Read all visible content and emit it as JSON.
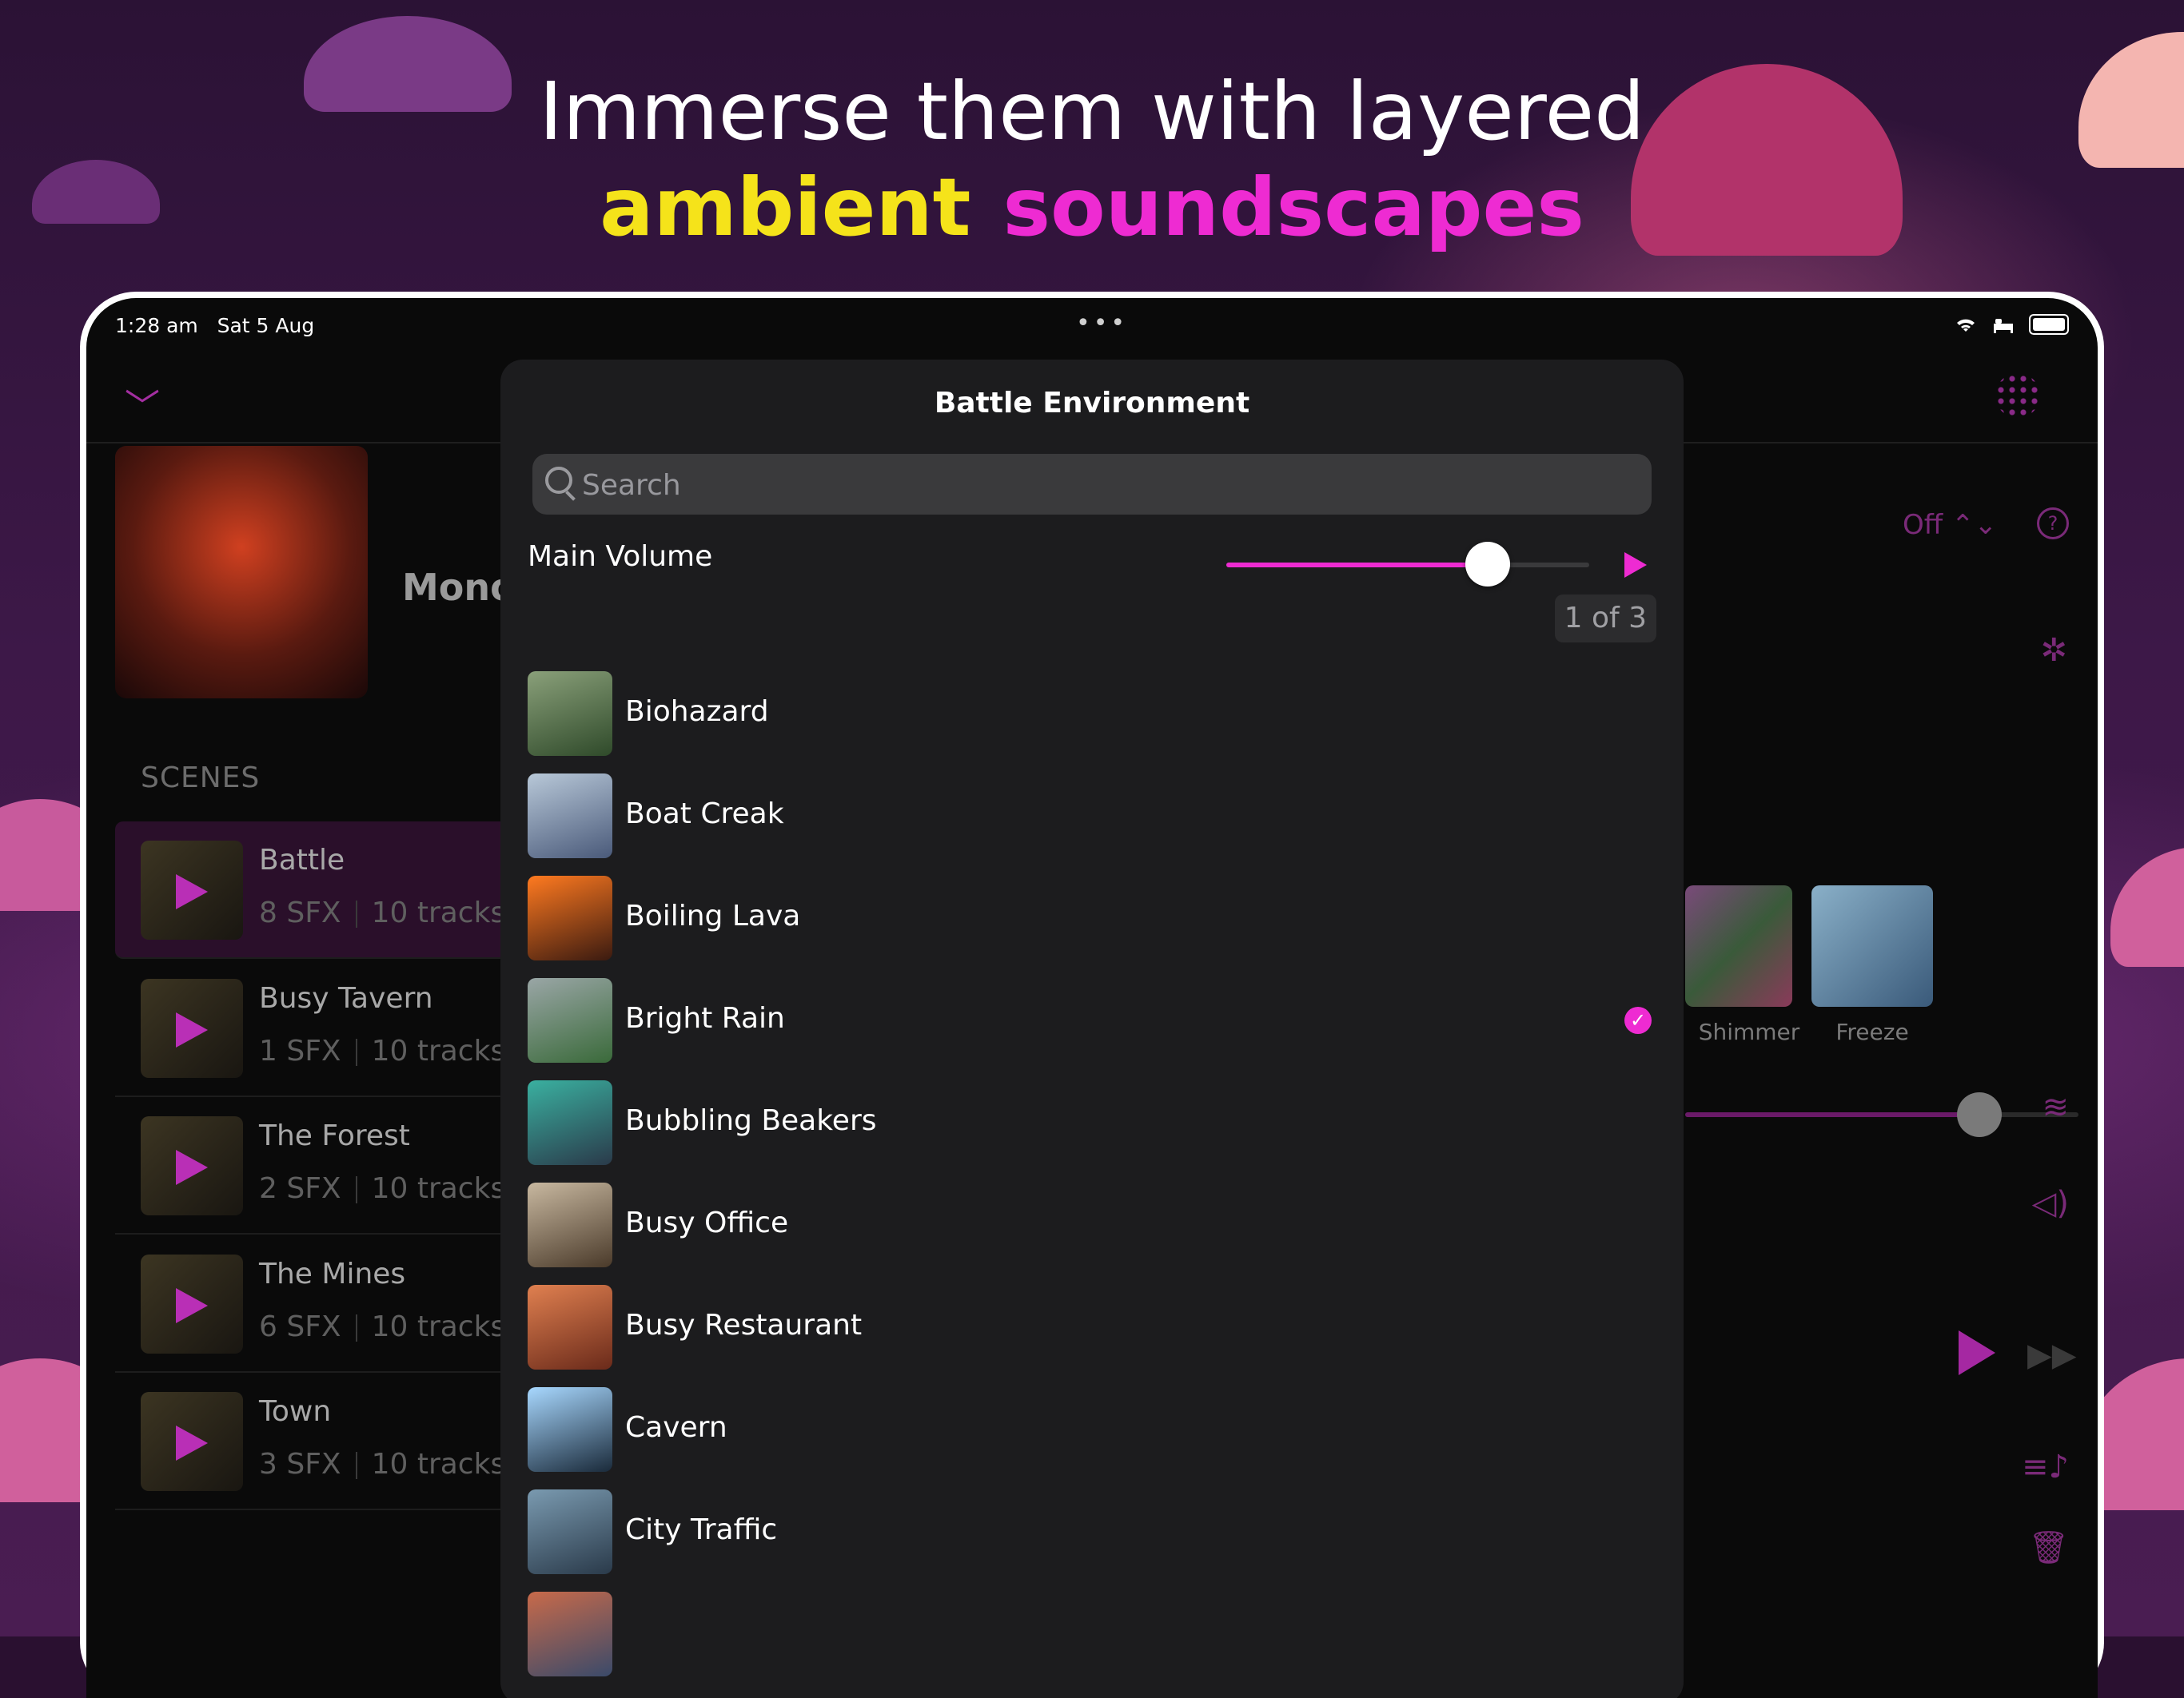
{
  "headline": {
    "line1": "Immerse them with layered",
    "word_yellow": "ambient",
    "word_pink": "soundscapes",
    "colors": {
      "yellow": "#f5e31a",
      "pink": "#ee2bd2"
    }
  },
  "status_bar": {
    "time": "1:28 am",
    "date": "Sat 5 Aug",
    "icons": [
      "wifi-icon",
      "bed-icon",
      "battery-icon"
    ]
  },
  "app": {
    "campaign_name": "Mono",
    "scenes_header": "SCENES",
    "scenes": [
      {
        "name": "Battle",
        "sfx": "8 SFX",
        "tracks": "10 tracks",
        "active": true
      },
      {
        "name": "Busy Tavern",
        "sfx": "1 SFX",
        "tracks": "10 tracks"
      },
      {
        "name": "The Forest",
        "sfx": "2 SFX",
        "tracks": "10 tracks"
      },
      {
        "name": "The Mines",
        "sfx": "6 SFX",
        "tracks": "10 tracks"
      },
      {
        "name": "Town",
        "sfx": "3 SFX",
        "tracks": "10 tracks"
      }
    ],
    "off_selector": "Off ⌃⌄",
    "help_glyph": "?",
    "effects": [
      {
        "label": "Shimmer",
        "color": "#6a4a6a"
      },
      {
        "label": "Freeze",
        "color": "#6a8aa8"
      }
    ]
  },
  "sheet": {
    "title": "Battle Environment",
    "search_placeholder": "Search",
    "main_volume_label": "Main Volume",
    "main_volume_level": 0.72,
    "pager": "1 of 3",
    "accent": "#ee2bd2",
    "items": [
      {
        "name": "Biohazard",
        "thumb": [
          "#8aa07a",
          "#2f4a2a"
        ]
      },
      {
        "name": "Boat Creak",
        "thumb": [
          "#b8c8d8",
          "#4a5a7a"
        ]
      },
      {
        "name": "Boiling Lava",
        "thumb": [
          "#ff7a20",
          "#3a1a10"
        ]
      },
      {
        "name": "Bright Rain",
        "thumb": [
          "#9aa6a6",
          "#3a6a3a"
        ],
        "selected": true
      },
      {
        "name": "Bubbling Beakers",
        "thumb": [
          "#3ab0a0",
          "#2a3a4a"
        ]
      },
      {
        "name": "Busy Office",
        "thumb": [
          "#c8b8a0",
          "#4a3a2a"
        ]
      },
      {
        "name": "Busy Restaurant",
        "thumb": [
          "#e08050",
          "#6a2a1a"
        ]
      },
      {
        "name": "Cavern",
        "thumb": [
          "#a8d8ff",
          "#1a2a3a"
        ]
      },
      {
        "name": "City Traffic",
        "thumb": [
          "#7a9ab0",
          "#2a3a4a"
        ]
      }
    ]
  }
}
